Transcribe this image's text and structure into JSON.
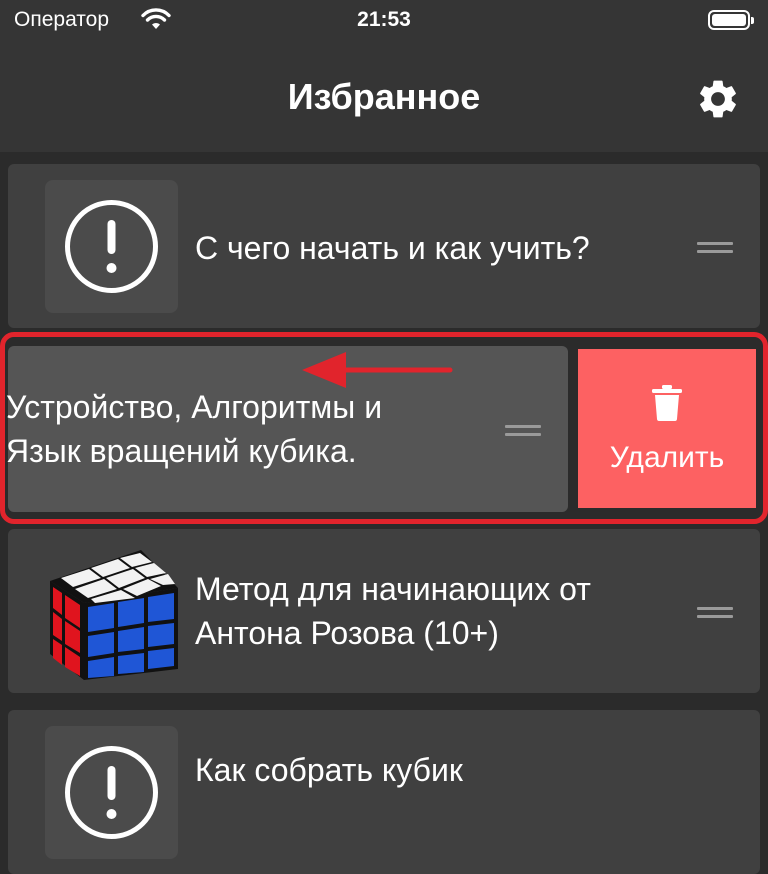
{
  "status_bar": {
    "carrier": "Оператор",
    "time": "21:53",
    "battery_level": 1.0
  },
  "nav": {
    "title": "Избранное",
    "settings_icon": "gear-icon"
  },
  "favorites": [
    {
      "title_lines": [
        "С чего начать и как учить?"
      ],
      "icon": "exclamation-circle-icon"
    },
    {
      "title_lines": [
        "Устройство, Алгоритмы и",
        "Язык вращений кубика."
      ],
      "swiped": true
    },
    {
      "title_lines": [
        "Метод для начинающих от",
        "Антона Розова (10+)"
      ],
      "icon": "rubiks-cube-icon"
    },
    {
      "title_lines": [
        "Как собрать кубик"
      ],
      "icon": "exclamation-circle-icon"
    }
  ],
  "swipe_action": {
    "label": "Удалить",
    "icon": "trash-icon",
    "color": "#fd6162"
  },
  "annotation": {
    "highlight_color": "#e1242c",
    "arrow_direction": "left"
  },
  "colors": {
    "background": "#2b2b2b",
    "cell": "#404040",
    "swiped_cell": "#555555",
    "bar": "#353535"
  }
}
